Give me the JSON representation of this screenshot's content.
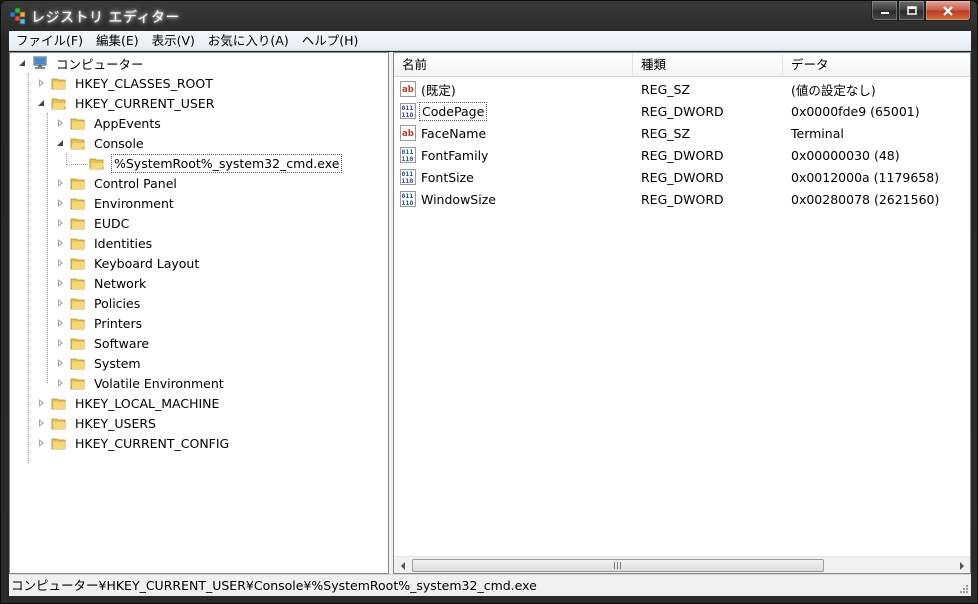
{
  "window": {
    "title": "レジストリ エディター",
    "icon": "regedit-icon"
  },
  "menu": [
    {
      "label": "ファイル(F)"
    },
    {
      "label": "編集(E)"
    },
    {
      "label": "表示(V)"
    },
    {
      "label": "お気に入り(A)"
    },
    {
      "label": "ヘルプ(H)"
    }
  ],
  "tree": {
    "root": "コンピューター",
    "items": [
      {
        "label": "HKEY_CLASSES_ROOT",
        "state": "collapsed"
      },
      {
        "label": "HKEY_CURRENT_USER",
        "state": "expanded"
      },
      {
        "label": "AppEvents",
        "state": "collapsed"
      },
      {
        "label": "Console",
        "state": "expanded"
      },
      {
        "label": "%SystemRoot%_system32_cmd.exe",
        "state": "none",
        "selected": true
      },
      {
        "label": "Control Panel",
        "state": "collapsed"
      },
      {
        "label": "Environment",
        "state": "collapsed"
      },
      {
        "label": "EUDC",
        "state": "collapsed"
      },
      {
        "label": "Identities",
        "state": "collapsed"
      },
      {
        "label": "Keyboard Layout",
        "state": "collapsed"
      },
      {
        "label": "Network",
        "state": "collapsed"
      },
      {
        "label": "Policies",
        "state": "collapsed"
      },
      {
        "label": "Printers",
        "state": "collapsed"
      },
      {
        "label": "Software",
        "state": "collapsed"
      },
      {
        "label": "System",
        "state": "collapsed"
      },
      {
        "label": "Volatile Environment",
        "state": "collapsed"
      },
      {
        "label": "HKEY_LOCAL_MACHINE",
        "state": "collapsed"
      },
      {
        "label": "HKEY_USERS",
        "state": "collapsed"
      },
      {
        "label": "HKEY_CURRENT_CONFIG",
        "state": "collapsed"
      }
    ]
  },
  "list": {
    "columns": {
      "name": "名前",
      "type": "種類",
      "data": "データ"
    },
    "rows": [
      {
        "icon": "string-value-icon",
        "name": "(既定)",
        "type": "REG_SZ",
        "data": "(値の設定なし)"
      },
      {
        "icon": "binary-value-icon",
        "name": "CodePage",
        "type": "REG_DWORD",
        "data": "0x0000fde9 (65001)",
        "focused": true
      },
      {
        "icon": "string-value-icon",
        "name": "FaceName",
        "type": "REG_SZ",
        "data": "Terminal"
      },
      {
        "icon": "binary-value-icon",
        "name": "FontFamily",
        "type": "REG_DWORD",
        "data": "0x00000030 (48)"
      },
      {
        "icon": "binary-value-icon",
        "name": "FontSize",
        "type": "REG_DWORD",
        "data": "0x0012000a (1179658)"
      },
      {
        "icon": "binary-value-icon",
        "name": "WindowSize",
        "type": "REG_DWORD",
        "data": "0x00280078 (2621560)"
      }
    ]
  },
  "status": {
    "path": "コンピューター¥HKEY_CURRENT_USER¥Console¥%SystemRoot%_system32_cmd.exe"
  },
  "colors": {
    "folder": "#e8c15a",
    "string_icon": "#c0392b",
    "binary_icon": "#2a4f9e"
  }
}
